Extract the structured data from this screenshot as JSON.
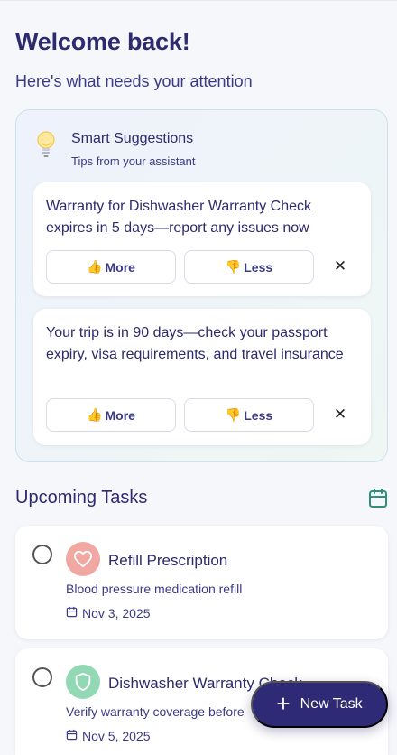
{
  "header": {
    "title": "Welcome back!",
    "subtitle": "Here's what needs your attention"
  },
  "smart_suggestions": {
    "title": "Smart Suggestions",
    "subtitle": "Tips from your assistant",
    "icon": "lightbulb-icon",
    "items": [
      {
        "text": "Warranty for Dishwasher Warranty Check expires in 5 days—report any issues now",
        "more_label": "More",
        "less_label": "Less"
      },
      {
        "text": "Your trip is in 90 days—check your passport expiry, visa requirements, and travel insurance",
        "more_label": "More",
        "less_label": "Less"
      }
    ]
  },
  "upcoming": {
    "title": "Upcoming Tasks",
    "tasks": [
      {
        "name": "Refill Prescription",
        "description": "Blood pressure medication refill",
        "date": "Nov 3, 2025",
        "icon": "heart-icon",
        "color": "#f2a8a2"
      },
      {
        "name": "Dishwasher Warranty Check",
        "description": "Verify warranty coverage before",
        "date": "Nov 5, 2025",
        "icon": "shield-icon",
        "color": "#92d8b5"
      }
    ]
  },
  "fab": {
    "label": "New Task"
  },
  "colors": {
    "primary": "#2e2a76",
    "text": "#2d2a6e",
    "accent_health": "#f2a8a2",
    "accent_home": "#92d8b5"
  }
}
